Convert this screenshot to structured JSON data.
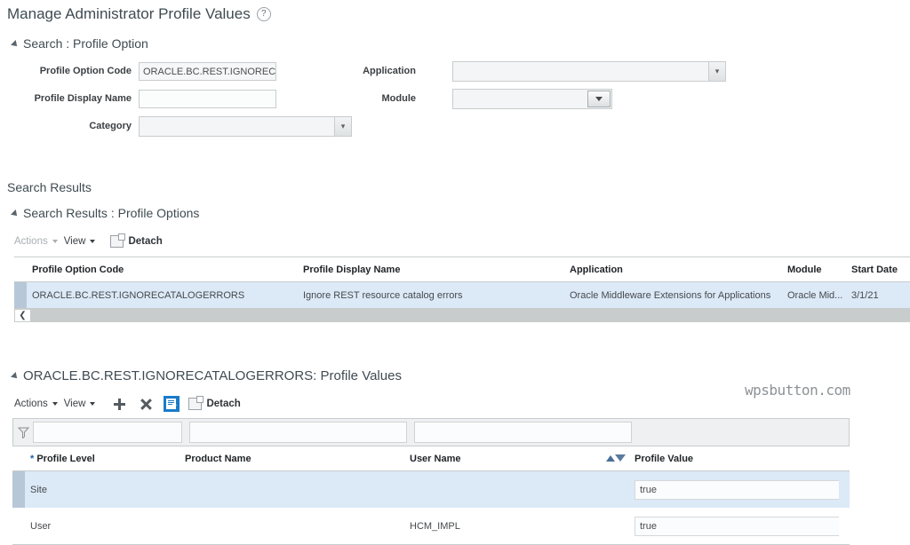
{
  "page": {
    "title": "Manage Administrator Profile Values",
    "help_icon": "help-circle-icon"
  },
  "search_section": {
    "header": "Search : Profile Option",
    "fields": {
      "profile_option_code": {
        "label": "Profile Option Code",
        "value": "ORACLE.BC.REST.IGNORECAT."
      },
      "profile_display_name": {
        "label": "Profile Display Name",
        "value": ""
      },
      "category": {
        "label": "Category",
        "value": ""
      },
      "application": {
        "label": "Application",
        "value": ""
      },
      "module": {
        "label": "Module",
        "value": ""
      }
    }
  },
  "search_results": {
    "heading": "Search Results",
    "section_header": "Search Results : Profile Options",
    "toolbar": {
      "actions": "Actions",
      "view": "View",
      "detach": "Detach"
    },
    "columns": [
      "Profile Option Code",
      "Profile Display Name",
      "Application",
      "Module",
      "Start Date"
    ],
    "rows": [
      {
        "profile_option_code": "ORACLE.BC.REST.IGNORECATALOGERRORS",
        "profile_display_name": "Ignore REST resource catalog errors",
        "application": "Oracle Middleware Extensions for Applications",
        "module": "Oracle Mid...",
        "start_date": "3/1/21"
      }
    ],
    "scroll_left_icon": "chevron-left-icon"
  },
  "profile_values": {
    "section_header": "ORACLE.BC.REST.IGNORECATALOGERRORS: Profile Values",
    "toolbar": {
      "actions": "Actions",
      "view": "View",
      "add": "add-row-icon",
      "delete": "delete-row-icon",
      "query_by_example": "query-by-example-icon",
      "detach": "Detach"
    },
    "filter_row": {
      "icon": "query-filter-icon",
      "profile_level": "",
      "product_name": "",
      "user_name": ""
    },
    "columns": [
      {
        "label": "Profile Level",
        "required": true
      },
      {
        "label": "Product Name",
        "required": false
      },
      {
        "label": "User Name",
        "required": false
      },
      {
        "label": "Profile Value",
        "required": false
      }
    ],
    "sort_indicator": {
      "ascending": "sort-ascending-icon",
      "descending": "sort-descending-icon"
    },
    "rows": [
      {
        "profile_level": "Site",
        "product_name": "",
        "user_name": "",
        "profile_value": "true",
        "selected": true
      },
      {
        "profile_level": "User",
        "product_name": "",
        "user_name": "HCM_IMPL",
        "profile_value": "true",
        "selected": false
      }
    ]
  },
  "watermark": "wpsbutton.com",
  "colors": {
    "accent_blue": "#1a7bc9",
    "selected_row": "#dce9f7",
    "row_handle": "#b7c7d8",
    "text": "#3f4b52"
  }
}
